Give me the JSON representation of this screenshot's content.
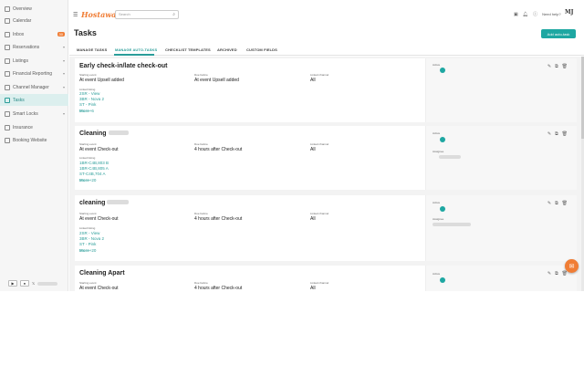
{
  "sidebar": {
    "items": [
      {
        "label": "Overview",
        "icon": "grid-icon"
      },
      {
        "label": "Calendar",
        "icon": "calendar-icon"
      },
      {
        "label": "Inbox",
        "icon": "inbox-icon",
        "badge": "30"
      },
      {
        "label": "Reservations",
        "icon": "reservations-icon"
      },
      {
        "label": "Listings",
        "icon": "home-icon"
      },
      {
        "label": "Financial Reporting",
        "icon": "chart-icon"
      },
      {
        "label": "Channel Manager",
        "icon": "channel-icon"
      },
      {
        "label": "Tasks",
        "icon": "tasks-icon",
        "active": true
      },
      {
        "label": "Smart Locks",
        "icon": "lock-icon"
      },
      {
        "label": "Insurance",
        "icon": "shield-icon"
      },
      {
        "label": "Booking Website",
        "icon": "globe-icon"
      }
    ]
  },
  "topbar": {
    "logo": "Hostaway",
    "search_placeholder": "Search",
    "help_label": "Need help?",
    "avatar_initials": "MJ"
  },
  "page": {
    "title": "Tasks",
    "add_button": "Add auto-task"
  },
  "tabs": [
    {
      "label": "MANAGE TASKS"
    },
    {
      "label": "MANAGE AUTO-TASKS",
      "active": true
    },
    {
      "label": "CHECKLIST TEMPLATES"
    },
    {
      "label": "ARCHIVED"
    },
    {
      "label": "CUSTOM FIELDS"
    }
  ],
  "cards": [
    {
      "title": "Early check-in/late check-out",
      "event_label": "Starting event",
      "event_value": "At event Upsell added",
      "due_label": "Due before",
      "due_value": "At event Upsell added",
      "channel_label": "Linked channel",
      "channel_value": "All",
      "listing_label": "Linked listing",
      "listings": [
        "2SR - View",
        "3BR - Nova 2",
        "ST - Pink"
      ],
      "more_label": "More",
      "more_count": "+6",
      "status_label": "Active"
    },
    {
      "title": "Cleaning",
      "event_label": "Starting event",
      "event_value": "At event Check-out",
      "due_label": "Due before",
      "due_value": "4 hours after Check-out",
      "channel_label": "Linked channel",
      "channel_value": "All",
      "listing_label": "Linked listing",
      "listings": [
        "1BR-C4B,803 B",
        "1BR-C4B,805 A",
        "ST-C4B,704 A"
      ],
      "more_label": "More",
      "more_count": "+20",
      "status_label": "Active",
      "assignee_label": "Assignee"
    },
    {
      "title": "cleaning",
      "event_label": "Starting event",
      "event_value": "At event Check-out",
      "due_label": "Due before",
      "due_value": "4 hours after Check-out",
      "channel_label": "Linked channel",
      "channel_value": "All",
      "listing_label": "Linked listing",
      "listings": [
        "2SR - View",
        "3BR - Nova 2",
        "ST - Pink"
      ],
      "more_label": "More",
      "more_count": "+20",
      "status_label": "Active",
      "assignee_label": "Assignee"
    },
    {
      "title": "Cleaning Apart",
      "event_label": "Starting event",
      "event_value": "At event Check-out",
      "due_label": "Due before",
      "due_value": "4 hours after Check-out",
      "channel_label": "Linked channel",
      "channel_value": "All",
      "status_label": "Active"
    }
  ],
  "colors": {
    "accent": "#1ea7a2",
    "brand": "#f07d35",
    "sidebar_bg": "#f6f6f6"
  }
}
